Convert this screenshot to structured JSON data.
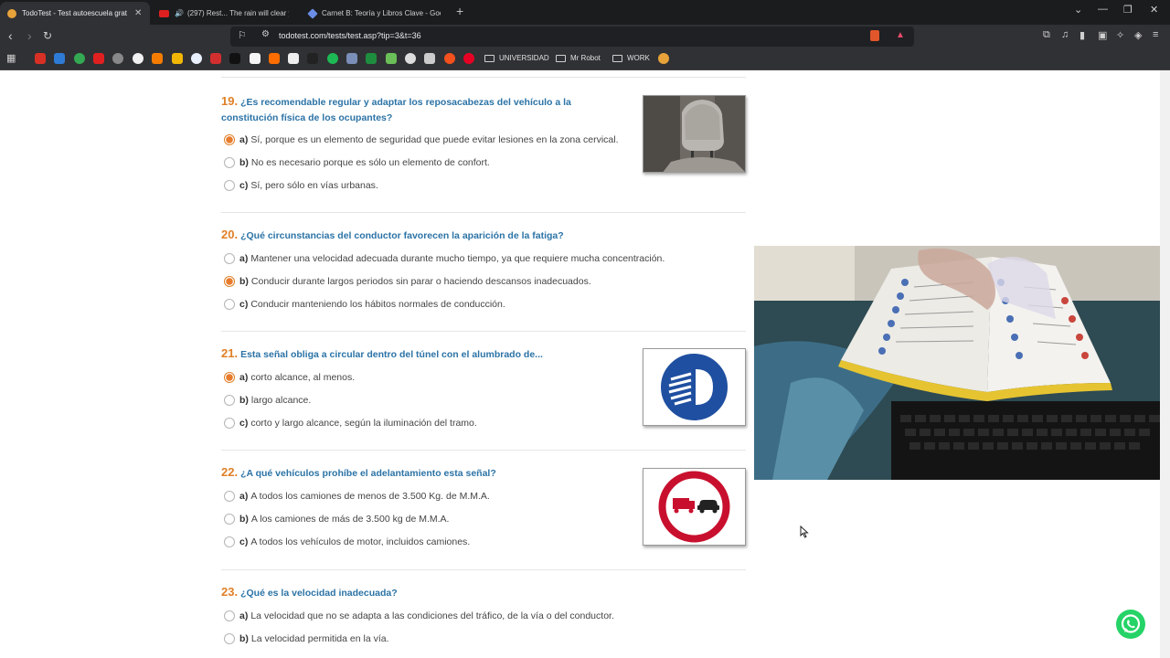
{
  "browser": {
    "tabs": [
      {
        "title": "TodoTest - Test autoescuela grat",
        "active": true
      },
      {
        "title": "(297) Rest... The rain will clear yo",
        "active": false
      },
      {
        "title": "Carnet B: Teoría y Libros Clave - Goo",
        "active": false
      }
    ],
    "url": "todotest.com/tests/test.asp?tip=3&t=36",
    "bookmark_folders": [
      "UNIVERSIDAD",
      "Mr Robot",
      "WORK"
    ]
  },
  "questions": [
    {
      "number": "19.",
      "text": "¿Es recomendable regular y adaptar los reposacabezas del vehículo a la constitución física de los ocupantes?",
      "options": [
        {
          "letter": "a)",
          "text": "Sí, porque es un elemento de seguridad que puede evitar lesiones en la zona cervical.",
          "selected": true
        },
        {
          "letter": "b)",
          "text": "No es necesario porque es sólo un elemento de confort.",
          "selected": false
        },
        {
          "letter": "c)",
          "text": "Sí, pero sólo en vías urbanas.",
          "selected": false
        }
      ]
    },
    {
      "number": "20.",
      "text": "¿Qué circunstancias del conductor favorecen la aparición de la fatiga?",
      "options": [
        {
          "letter": "a)",
          "text": "Mantener una velocidad adecuada durante mucho tiempo, ya que requiere mucha concentración.",
          "selected": false
        },
        {
          "letter": "b)",
          "text": "Conducir durante largos periodos sin parar o haciendo descansos inadecuados.",
          "selected": true
        },
        {
          "letter": "c)",
          "text": "Conducir manteniendo los hábitos normales de conducción.",
          "selected": false
        }
      ]
    },
    {
      "number": "21.",
      "text": "Esta señal obliga a circular dentro del túnel con el alumbrado de...",
      "options": [
        {
          "letter": "a)",
          "text": "corto alcance, al menos.",
          "selected": true
        },
        {
          "letter": "b)",
          "text": "largo alcance.",
          "selected": false
        },
        {
          "letter": "c)",
          "text": "corto y largo alcance, según la iluminación del tramo.",
          "selected": false
        }
      ]
    },
    {
      "number": "22.",
      "text": "¿A qué vehículos prohíbe el adelantamiento esta señal?",
      "options": [
        {
          "letter": "a)",
          "text": "A todos los camiones de menos de 3.500 Kg. de M.M.A.",
          "selected": false
        },
        {
          "letter": "b)",
          "text": "A los camiones de más de 3.500 kg de M.M.A.",
          "selected": false
        },
        {
          "letter": "c)",
          "text": "A todos los vehículos de motor, incluidos camiones.",
          "selected": false
        }
      ]
    },
    {
      "number": "23.",
      "text": "¿Qué es la velocidad inadecuada?",
      "options": [
        {
          "letter": "a)",
          "text": "La velocidad que no se adapta a las condiciones del tráfico, de la vía o del conductor.",
          "selected": false
        },
        {
          "letter": "b)",
          "text": "La velocidad permitida en la vía.",
          "selected": false
        }
      ]
    }
  ],
  "colors": {
    "question_text": "#2b73a6",
    "question_number": "#e07f26",
    "selected_radio": "#e87c2c"
  }
}
